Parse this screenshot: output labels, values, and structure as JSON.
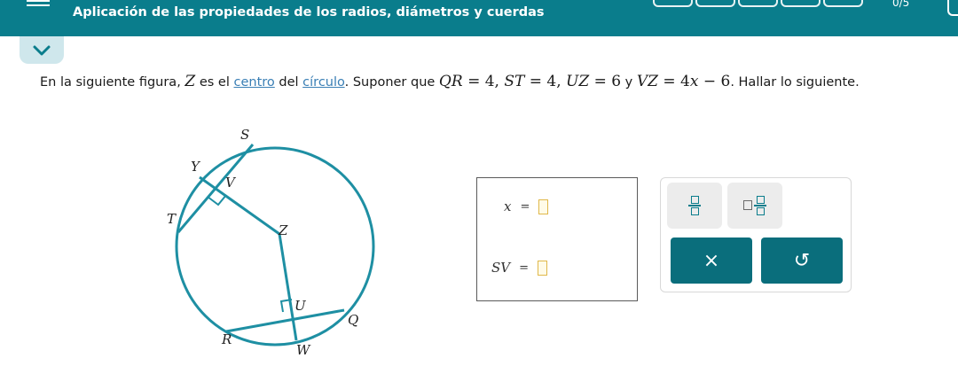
{
  "header": {
    "title": "Aplicación de las propiedades de los radios, diámetros y cuerdas",
    "progress_count": "0/5",
    "progress_segments": 5
  },
  "problem": {
    "part1": "En la siguiente figura, ",
    "center_var": "Z",
    "part2": " es el ",
    "link_centro": "centro",
    "part3": " del ",
    "link_circulo": "círculo",
    "part4": ". Suponer que ",
    "eq1_var": "QR",
    "eq1_val": " = 4, ",
    "eq2_var": "ST",
    "eq2_val": " = 4, ",
    "eq3_var": "UZ",
    "eq3_val": " = 6",
    "and_word": " y ",
    "eq4_var": "VZ",
    "eq4_mid": " = 4",
    "eq4_x": "x",
    "eq4_end": " − 6",
    "part5": ". Hallar lo siguiente."
  },
  "figure": {
    "labels": {
      "S": "S",
      "Y": "Y",
      "V": "V",
      "T": "T",
      "Z": "Z",
      "U": "U",
      "Q": "Q",
      "R": "R",
      "W": "W"
    }
  },
  "answers": {
    "x_label": "x",
    "x_eq": "=",
    "sv_label": "SV",
    "sv_eq": "="
  },
  "tools": {
    "fraction": "fraction-icon",
    "mixed_number": "mixed-number-icon",
    "clear_label": "×",
    "undo_label": "↺"
  },
  "colors": {
    "header": "#0a7d8c",
    "circle": "#1e8fa3",
    "action": "#0a6e7c",
    "input_border": "#e0b84a"
  }
}
